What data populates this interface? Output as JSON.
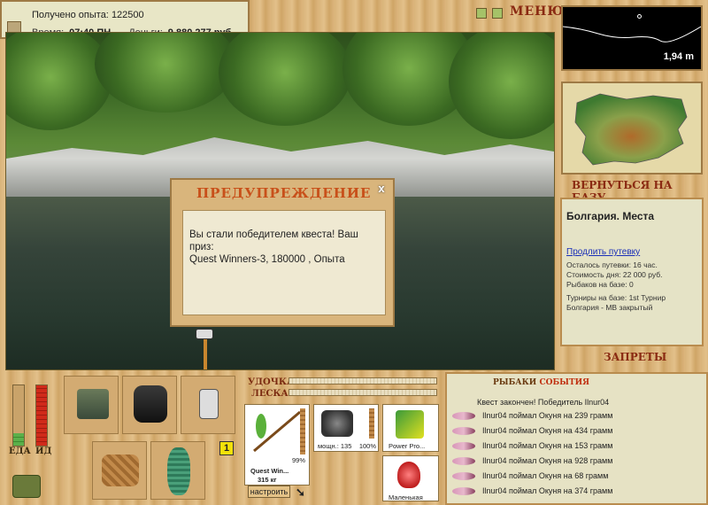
{
  "info": {
    "experience_label": "Получено опыта:",
    "experience_value": "122500",
    "time_label": "Время:",
    "time_value": "07:40 ПН",
    "money_label": "Деньги:",
    "money_value": "9 880 277 руб."
  },
  "header": {
    "menu_label": "МЕНЮ"
  },
  "dialog": {
    "title": "ПРЕДУПРЕЖДЕНИЕ",
    "close_symbol": "x",
    "line1": "Вы стали победителем квеста! Ваш приз:",
    "line2": "Quest Winners-3, 180000 , Опыта"
  },
  "minimap": {
    "depth": "1,94 m"
  },
  "right": {
    "return_base": "ВЕРНУТЬСЯ НА БАЗУ",
    "place_title": "Болгария. Места",
    "extend_link": "Продлить путевку",
    "lines": [
      "Осталось путевки: 16 час.",
      "Стоимость дня: 22 000 руб.",
      "Рыбаков на базе: 0"
    ],
    "tournament_line1": "Турниры на базе: 1st Турнир",
    "tournament_line2": "Болгария - MB закрытый",
    "bans": "ЗАПРЕТЫ"
  },
  "stats": {
    "food_label": "ЕДА",
    "health_label": "ИД",
    "slot_badge": "1",
    "food_level": 0.2,
    "health_level": 1.0
  },
  "equipment": {
    "rod_label": "УДОЧКА",
    "line_label": "ЛЕСКА",
    "rod_name": "Quest Win...",
    "rod_capacity": "315 кг",
    "rod_percent": "99%",
    "reel_power": "мощн.: 135",
    "reel_percent": "100%",
    "lure_name": "Power Pro...",
    "bait_name": "Маленькая",
    "tune_button": "настроить"
  },
  "events": {
    "title_part1": "РЫБАКИ",
    "title_part2": "СОБЫТИЯ",
    "first": "Квест закончен! Победитель Ilnur04",
    "items": [
      "Ilnur04 поймал Окуня на 239 грамм",
      "Ilnur04 поймал Окуня на 434 грамм",
      "Ilnur04 поймал Окуня на 153 грамм",
      "Ilnur04 поймал Окуня на 928 грамм",
      "Ilnur04 поймал Окуня на 68 грамм",
      "Ilnur04 поймал Окуня на 374 грамм"
    ]
  }
}
